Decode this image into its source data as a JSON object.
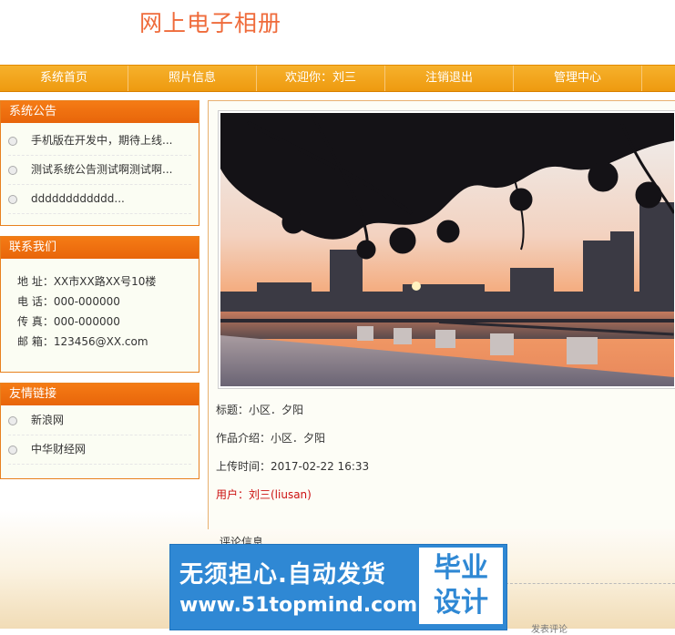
{
  "header": {
    "title": "网上电子相册"
  },
  "nav": {
    "items": [
      {
        "label": "系统首页"
      },
      {
        "label": "照片信息"
      },
      {
        "label": "欢迎你：刘三"
      },
      {
        "label": "注销退出"
      },
      {
        "label": "管理中心"
      }
    ]
  },
  "notices": {
    "title": "系统公告",
    "items": [
      {
        "text": "手机版在开发中，期待上线..."
      },
      {
        "text": "测试系统公告测试啊测试啊..."
      },
      {
        "text": "dddddddddddd..."
      }
    ]
  },
  "contact": {
    "title": "联系我们",
    "address": "地 址：XX市XX路XX号10楼",
    "phone": "电 话：000-000000",
    "fax": "传 真：000-000000",
    "email": "邮 箱：123456@XX.com"
  },
  "links": {
    "title": "友情链接",
    "items": [
      {
        "text": "新浪网"
      },
      {
        "text": "中华财经网"
      }
    ]
  },
  "photo": {
    "title_line": "标题：小区．夕阳",
    "intro_line": "作品介绍：小区．夕阳",
    "upload_line": "上传时间：2017-02-22 16:33",
    "user_line": "用户：刘三(liusan)"
  },
  "comments": {
    "title": "评论信息",
    "footer_hint": "发表评论"
  },
  "watermark": {
    "line1": "无须担心.自动发货",
    "line2": "www.51topmind.com",
    "badge_top": "毕业",
    "badge_bottom": "设计"
  },
  "colors": {
    "accent": "#f29b14",
    "box_header": "#f06d0f",
    "title": "#ef6b3b",
    "user_text": "#cc1111"
  }
}
